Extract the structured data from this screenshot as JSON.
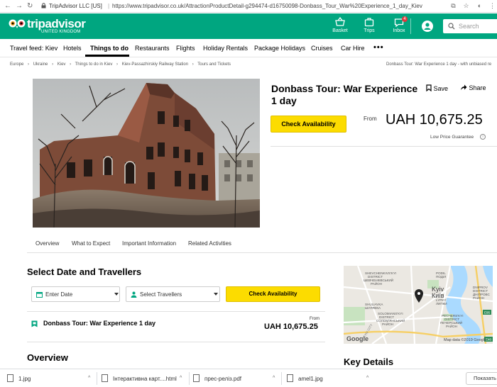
{
  "browser": {
    "site_identity": "TripAdvisor LLC [US]",
    "url": "https://www.tripadvisor.co.uk/AttractionProductDetail-g294474-d16750098-Donbass_Tour_War%20Experience_1_day_Kiev"
  },
  "header": {
    "logo_text": "tripadvisor",
    "logo_sub": "UNITED KINGDOM",
    "basket_label": "Basket",
    "trips_label": "Trips",
    "inbox_label": "Inbox",
    "inbox_count": "4",
    "search_placeholder": "Search"
  },
  "nav": {
    "items": [
      "Travel feed: Kiev",
      "Hotels",
      "Things to do",
      "Restaurants",
      "Flights",
      "Holiday Rentals",
      "Package Holidays",
      "Cruises",
      "Car Hire"
    ],
    "active": "Things to do",
    "more": "•••"
  },
  "breadcrumbs": [
    "Europe",
    "›",
    "Ukraine",
    "›",
    "Kiev",
    "›",
    "Things to do in Kiev",
    "›",
    "Kiev-Passazhirskiy Railway Station",
    "›",
    "Tours and Tickets"
  ],
  "breadcrumb_tail": "Donbass Tour: War Experience 1 day - with unbiased re",
  "product": {
    "title": "Donbass Tour: War Experience 1 day",
    "save_label": "Save",
    "share_label": "Share",
    "check_label": "Check Availability",
    "from_label": "From",
    "price": "UAH 10,675.25",
    "guarantee": "Low Price Guarantee",
    "info_glyph": "i"
  },
  "tabs": [
    "Overview",
    "What to Expect",
    "Important Information",
    "Related Activities"
  ],
  "booking": {
    "title": "Select Date and Travellers",
    "date_label": "Enter Date",
    "travellers_label": "Select Travellers",
    "check_label": "Check Availability",
    "offer_name": "Donbass Tour: War Experience 1 day",
    "from_label": "From",
    "price": "UAH 10,675.25"
  },
  "overview_heading": "Overview",
  "map": {
    "labels": {
      "shevchenkivskyi": [
        "SHEVCHENKIVS'KYI",
        "DISTRICT",
        "ШЕВЧЕНКІВСЬКИЙ",
        "РАЙОН"
      ],
      "podil": [
        "PODIL",
        "ПОДІЛ"
      ],
      "dnipro": [
        "DNIPROV",
        "DISTRICT",
        "ДНІПРОВС",
        "РАЙОН"
      ],
      "kyiv_en": "Kyiv",
      "kyiv_ua": "Київ",
      "shuliavka": [
        "SHULIAVKA",
        "ШУЛЯВКА"
      ],
      "lypky": [
        "LYPKY",
        "ЛИПКИ"
      ],
      "solomianskyi": [
        "SOLOMIANS'KYI",
        "DISTRICT",
        "СОЛОМ'ЯНСЬКИЙ",
        "РАЙОН"
      ],
      "pechersky": [
        "PECHERS'KYI",
        "DISTRICT",
        "ПЕЧЕРСЬКИЙ",
        "РАЙОН"
      ],
      "road_e95": "E95",
      "road_e40": "E40",
      "kyiv_city": "KYIV CITY"
    },
    "google": "Google",
    "attribution": "Map data ©2019 Google"
  },
  "key_details": "Key Details",
  "downloads": [
    {
      "name": "1.jpg"
    },
    {
      "name": "Інтерактивна карт....html"
    },
    {
      "name": "прес-реліз.pdf"
    },
    {
      "name": "amel1.jpg"
    }
  ],
  "show_all": "Показать",
  "colors": {
    "brand_green": "#00a680",
    "button_yellow": "#fcdc00"
  }
}
